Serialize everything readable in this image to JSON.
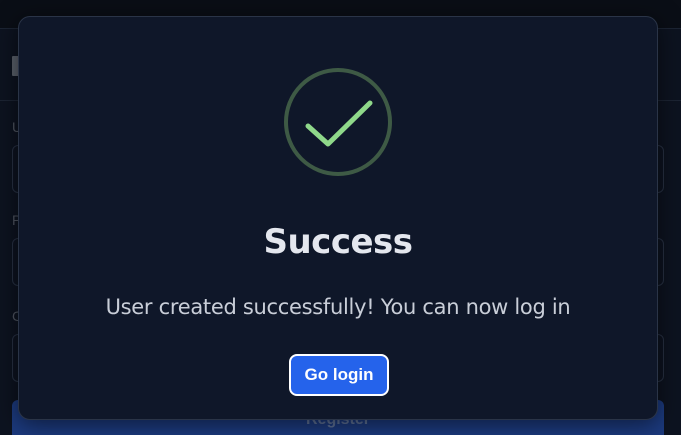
{
  "background_form": {
    "header_initial": "",
    "labels": [
      "U",
      "P",
      "C"
    ],
    "register_label": "Register"
  },
  "modal": {
    "icon": "check-circle-icon",
    "title": "Success",
    "message": "User created successfully! You can now log in",
    "button_label": "Go login"
  },
  "colors": {
    "backdrop": "#0a0e16",
    "modal_bg": "#0f1729",
    "modal_border": "#2a3447",
    "check_ring": "#3e5a45",
    "check_mark": "#8fd88a",
    "button_bg": "#2563eb",
    "button_border": "#ffffff",
    "title_text": "#e4e7ee",
    "message_text": "#c9ced8"
  }
}
